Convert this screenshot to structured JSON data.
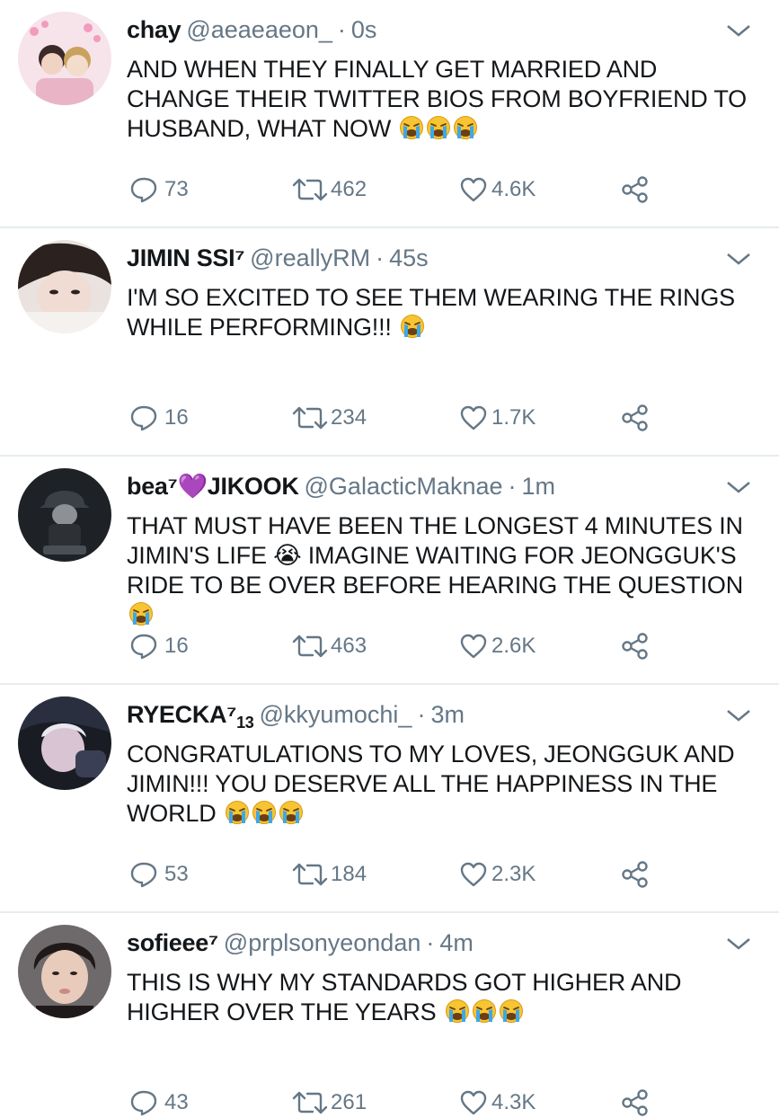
{
  "tweets": [
    {
      "display_name": "chay",
      "name_heart": "",
      "name_suffix": "",
      "name_sub": "",
      "handle": "@aeaeaeon_",
      "time": "0s",
      "text": "AND WHEN THEY FINALLY GET MARRIED AND CHANGE THEIR TWITTER BIOS FROM BOYFRIEND TO HUSBAND, WHAT NOW",
      "emoji_count": 3,
      "replies": "73",
      "retweets": "462",
      "likes": "4.6K"
    },
    {
      "display_name": "JIMIN SSI⁷",
      "name_heart": "",
      "name_suffix": "",
      "name_sub": "",
      "handle": "@reallyRM",
      "time": "45s",
      "text": "I'M SO EXCITED TO SEE THEM WEARING THE RINGS WHILE PERFORMING!!!",
      "emoji_count": 1,
      "replies": "16",
      "retweets": "234",
      "likes": "1.7K"
    },
    {
      "display_name": "bea⁷",
      "name_heart": "💜",
      "name_suffix": "JIKOOK",
      "name_sub": "",
      "handle": "@GalacticMaknae",
      "time": "1m",
      "text": "THAT MUST HAVE BEEN THE LONGEST 4 MINUTES IN JIMIN'S LIFE 😭 IMAGINE WAITING FOR JEONGGUK'S RIDE TO BE OVER BEFORE HEARING THE QUESTION",
      "emoji_count": 1,
      "replies": "16",
      "retweets": "463",
      "likes": "2.6K"
    },
    {
      "display_name": "RYECKA⁷",
      "name_heart": "",
      "name_suffix": "",
      "name_sub": "13",
      "handle": "@kkyumochi_",
      "time": "3m",
      "text": "CONGRATULATIONS TO MY LOVES, JEONGGUK AND JIMIN!!! YOU DESERVE ALL THE HAPPINESS IN THE WORLD",
      "emoji_count": 3,
      "replies": "53",
      "retweets": "184",
      "likes": "2.3K"
    },
    {
      "display_name": "sofieee⁷",
      "name_heart": "",
      "name_suffix": "",
      "name_sub": "",
      "handle": "@prplsonyeondan",
      "time": "4m",
      "text": "THIS IS WHY MY STANDARDS GOT HIGHER AND HIGHER OVER THE YEARS",
      "emoji_count": 3,
      "replies": "43",
      "retweets": "261",
      "likes": "4.3K"
    }
  ],
  "icons": {
    "reply": "reply-icon",
    "retweet": "retweet-icon",
    "like": "heart-icon",
    "share": "share-icon",
    "caret": "chevron-down-icon",
    "emoji": "loudly-crying-face-emoji"
  },
  "colors": {
    "text": "#14171a",
    "muted": "#657786",
    "divider": "#e6ecf0",
    "heart": "#7b2fbe"
  }
}
